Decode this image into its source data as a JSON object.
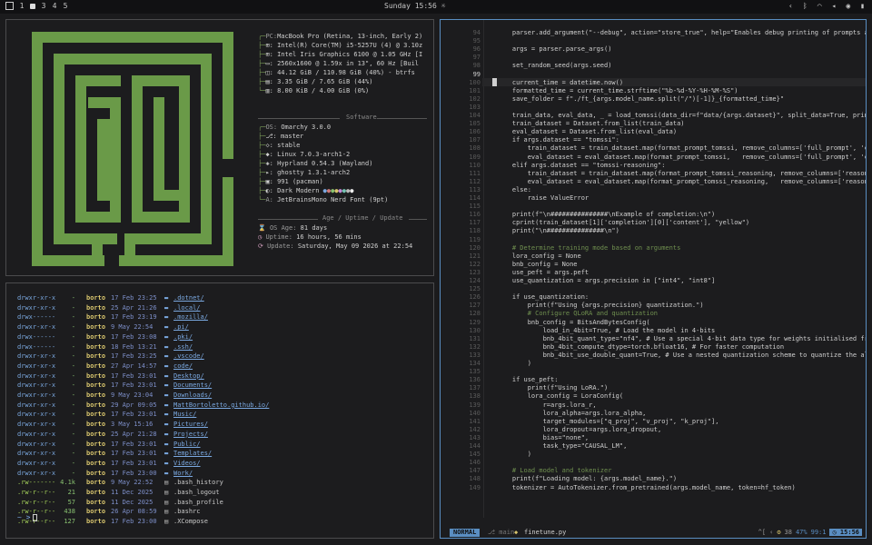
{
  "topbar": {
    "workspaces": [
      "1",
      "3",
      "4",
      "5"
    ],
    "clock": "Sunday 15:56",
    "tray_icons": [
      "chevron-left-icon",
      "bluetooth-icon",
      "wifi-icon",
      "volume-icon",
      "cpu-icon",
      "battery-icon"
    ]
  },
  "fetch": {
    "hw": [
      {
        "key": "PC:",
        "val": "MacBook Pro (Retina, 13-inch, Early 2)"
      },
      {
        "key": "",
        "val": "Intel(R) Core(TM) i5-5257U (4) @ 3.10z"
      },
      {
        "key": "",
        "val": "Intel Iris Graphics 6100 @ 1.05 GHz [I"
      },
      {
        "key": "",
        "val": "2560x1600 @ 1.59x in 13\", 60 Hz [Buil"
      },
      {
        "key": "",
        "val": "44.12 GiB / 110.98 GiB (40%) - btrfs"
      },
      {
        "key": "",
        "val": "3.35 GiB / 7.65 GiB (44%)"
      },
      {
        "key": "",
        "val": ": 8.00 KiB / 4.00 GiB (0%)"
      }
    ],
    "software_title": "Software",
    "sw": [
      {
        "key": "OS:",
        "val": "Omarchy 3.0.0"
      },
      {
        "key": "",
        "val": "master"
      },
      {
        "key": "",
        "val": "stable"
      },
      {
        "key": "",
        "val": "Linux 7.0.3-arch1-2"
      },
      {
        "key": "",
        "val": "Hyprland 0.54.3 (Wayland)"
      },
      {
        "key": "",
        "val": "ghostty 1.3.1-arch2"
      },
      {
        "key": "",
        "val": "991 (pacman)"
      },
      {
        "key": "",
        "val": "Dark Modern"
      },
      {
        "key": "A:",
        "val": "JetBrainsMono Nerd Font (9pt)"
      }
    ],
    "uptime_title": "Age / Uptime / Update",
    "age": {
      "key": "OS Age:",
      "val": "81 days"
    },
    "uptime": {
      "key": "Uptime:",
      "val": "16 hours, 56 mins"
    },
    "update": {
      "key": "Update:",
      "val": "Saturday, May 09 2026 at 22:54"
    }
  },
  "ls": {
    "rows": [
      {
        "perm": "drwxr-xr-x",
        "size": "-",
        "user": "borto",
        "date": "17 Feb 23:25",
        "name": ".dotnet/",
        "dir": true
      },
      {
        "perm": "drwxr-xr-x",
        "size": "-",
        "user": "borto",
        "date": "25 Apr 21:26",
        "name": ".local/",
        "dir": true
      },
      {
        "perm": "drwx------",
        "size": "-",
        "user": "borto",
        "date": "17 Feb 23:19",
        "name": ".mozilla/",
        "dir": true
      },
      {
        "perm": "drwxr-xr-x",
        "size": "-",
        "user": "borto",
        "date": "9 May 22:54",
        "name": ".pi/",
        "dir": true
      },
      {
        "perm": "drwx------",
        "size": "-",
        "user": "borto",
        "date": "17 Feb 23:08",
        "name": ".pki/",
        "dir": true
      },
      {
        "perm": "drwx------",
        "size": "-",
        "user": "borto",
        "date": "18 Feb 13:21",
        "name": ".ssh/",
        "dir": true
      },
      {
        "perm": "drwxr-xr-x",
        "size": "-",
        "user": "borto",
        "date": "17 Feb 23:25",
        "name": ".vscode/",
        "dir": true
      },
      {
        "perm": "drwxr-xr-x",
        "size": "-",
        "user": "borto",
        "date": "27 Apr 14:57",
        "name": "code/",
        "dir": true
      },
      {
        "perm": "drwxr-xr-x",
        "size": "-",
        "user": "borto",
        "date": "17 Feb 23:01",
        "name": "Desktop/",
        "dir": true
      },
      {
        "perm": "drwxr-xr-x",
        "size": "-",
        "user": "borto",
        "date": "17 Feb 23:01",
        "name": "Documents/",
        "dir": true
      },
      {
        "perm": "drwxr-xr-x",
        "size": "-",
        "user": "borto",
        "date": "9 May 23:04",
        "name": "Downloads/",
        "dir": true
      },
      {
        "perm": "drwxr-xr-x",
        "size": "-",
        "user": "borto",
        "date": "29 Apr 09:05",
        "name": "MattBortoletto.github.io/",
        "dir": true
      },
      {
        "perm": "drwxr-xr-x",
        "size": "-",
        "user": "borto",
        "date": "17 Feb 23:01",
        "name": "Music/",
        "dir": true
      },
      {
        "perm": "drwxr-xr-x",
        "size": "-",
        "user": "borto",
        "date": "3 May 15:16",
        "name": "Pictures/",
        "dir": true
      },
      {
        "perm": "drwxr-xr-x",
        "size": "-",
        "user": "borto",
        "date": "25 Apr 21:28",
        "name": "Projects/",
        "dir": true
      },
      {
        "perm": "drwxr-xr-x",
        "size": "-",
        "user": "borto",
        "date": "17 Feb 23:01",
        "name": "Public/",
        "dir": true
      },
      {
        "perm": "drwxr-xr-x",
        "size": "-",
        "user": "borto",
        "date": "17 Feb 23:01",
        "name": "Templates/",
        "dir": true
      },
      {
        "perm": "drwxr-xr-x",
        "size": "-",
        "user": "borto",
        "date": "17 Feb 23:01",
        "name": "Videos/",
        "dir": true
      },
      {
        "perm": "drwxr-xr-x",
        "size": "-",
        "user": "borto",
        "date": "17 Feb 23:00",
        "name": "Work/",
        "dir": true
      },
      {
        "perm": ".rw-------",
        "size": "4.1k",
        "user": "borto",
        "date": "9 May 22:52",
        "name": ".bash_history",
        "dir": false
      },
      {
        "perm": ".rw-r--r--",
        "size": "21",
        "user": "borto",
        "date": "11 Dec  2025",
        "name": ".bash_logout",
        "dir": false
      },
      {
        "perm": ".rw-r--r--",
        "size": "57",
        "user": "borto",
        "date": "11 Dec  2025",
        "name": ".bash_profile",
        "dir": false
      },
      {
        "perm": ".rw-r--r--",
        "size": "438",
        "user": "borto",
        "date": "26 Apr 08:59",
        "name": ".bashrc",
        "dir": false
      },
      {
        "perm": ".rw-r--r--",
        "size": "127",
        "user": "borto",
        "date": "17 Feb 23:00",
        "name": ".XCompose",
        "dir": false
      }
    ],
    "prompt": "~ >"
  },
  "editor": {
    "lines": [
      {
        "n": "94",
        "t": "    parser.add_argument(\"--debug\", action=\"store_true\", help=\"Enables debug printing of prompts an"
      },
      {
        "n": "95",
        "t": ""
      },
      {
        "n": "96",
        "t": "    args = parser.parse_args()"
      },
      {
        "n": "97",
        "t": ""
      },
      {
        "n": "98",
        "t": "    set_random_seed(args.seed)"
      },
      {
        "n": "99",
        "t": ""
      },
      {
        "n": "100",
        "t": "    current_time = datetime.now()"
      },
      {
        "n": "101",
        "t": "    formatted_time = current_time.strftime(\"%b-%d-%Y-%H-%M-%S\")"
      },
      {
        "n": "102",
        "t": "    save_folder = f\"./ft_{args.model_name.split(\"/\")[-1]}_{formatted_time}\""
      },
      {
        "n": "103",
        "t": ""
      },
      {
        "n": "104",
        "t": "    train_data, eval_data, _ = load_tomssi(data_dir=f\"data/{args.dataset}\", split_data=True, print"
      },
      {
        "n": "105",
        "t": "    train_dataset = Dataset.from_list(train_data)"
      },
      {
        "n": "106",
        "t": "    eval_dataset = Dataset.from_list(eval_data)"
      },
      {
        "n": "107",
        "t": "    if args.dataset == \"tomssi\":"
      },
      {
        "n": "108",
        "t": "        train_dataset = train_dataset.map(format_prompt_tomssi, remove_columns=['full_prompt', 'co"
      },
      {
        "n": "109",
        "t": "        eval_dataset = eval_dataset.map(format_prompt_tomssi,   remove_columns=['full_prompt', 'co"
      },
      {
        "n": "110",
        "t": "    elif args.dataset == \"tomssi-reasoning\":"
      },
      {
        "n": "111",
        "t": "        train_dataset = train_dataset.map(format_prompt_tomssi_reasoning, remove_columns=['reasoni"
      },
      {
        "n": "112",
        "t": "        eval_dataset = eval_dataset.map(format_prompt_tomssi_reasoning,   remove_columns=['reasoni"
      },
      {
        "n": "113",
        "t": "    else:"
      },
      {
        "n": "114",
        "t": "        raise ValueError"
      },
      {
        "n": "115",
        "t": ""
      },
      {
        "n": "116",
        "t": "    print(f\"\\n###############\\nExample of completion:\\n\")"
      },
      {
        "n": "117",
        "t": "    cprint(train_dataset[1]['completion'][0]['content'], \"yellow\")"
      },
      {
        "n": "118",
        "t": "    print(\"\\n###############\\n\")"
      },
      {
        "n": "119",
        "t": ""
      },
      {
        "n": "120",
        "t": "    # Determine training mode based on arguments"
      },
      {
        "n": "121",
        "t": "    lora_config = None"
      },
      {
        "n": "122",
        "t": "    bnb_config = None"
      },
      {
        "n": "123",
        "t": "    use_peft = args.peft"
      },
      {
        "n": "124",
        "t": "    use_quantization = args.precision in [\"int4\", \"int8\"]"
      },
      {
        "n": "125",
        "t": ""
      },
      {
        "n": "126",
        "t": "    if use_quantization:"
      },
      {
        "n": "127",
        "t": "        print(f\"Using {args.precision} quantization.\")"
      },
      {
        "n": "128",
        "t": "        # Configure QLoRA and quantization"
      },
      {
        "n": "129",
        "t": "        bnb_config = BitsAndBytesConfig("
      },
      {
        "n": "130",
        "t": "            load_in_4bit=True, # Load the model in 4-bits"
      },
      {
        "n": "131",
        "t": "            bnb_4bit_quant_type=\"nf4\", # Use a special 4-bit data type for weights initialised fro"
      },
      {
        "n": "132",
        "t": "            bnb_4bit_compute_dtype=torch.bfloat16, # For faster computation"
      },
      {
        "n": "133",
        "t": "            bnb_4bit_use_double_quant=True, # Use a nested quantization scheme to quantize the alr"
      },
      {
        "n": "134",
        "t": "        )"
      },
      {
        "n": "135",
        "t": ""
      },
      {
        "n": "136",
        "t": "    if use_peft:"
      },
      {
        "n": "137",
        "t": "        print(f\"Using LoRA.\")"
      },
      {
        "n": "138",
        "t": "        lora_config = LoraConfig("
      },
      {
        "n": "139",
        "t": "            r=args.lora_r,"
      },
      {
        "n": "140",
        "t": "            lora_alpha=args.lora_alpha,"
      },
      {
        "n": "141",
        "t": "            target_modules=[\"q_proj\", \"v_proj\", \"k_proj\"],"
      },
      {
        "n": "142",
        "t": "            lora_dropout=args.lora_dropout,"
      },
      {
        "n": "143",
        "t": "            bias=\"none\","
      },
      {
        "n": "144",
        "t": "            task_type=\"CAUSAL_LM\","
      },
      {
        "n": "145",
        "t": "        )"
      },
      {
        "n": "146",
        "t": ""
      },
      {
        "n": "147",
        "t": "    # Load model and tokenizer"
      },
      {
        "n": "148",
        "t": "    print(f\"Loading model: {args.model_name}.\")"
      },
      {
        "n": "149",
        "t": "    tokenizer = AutoTokenizer.from_pretrained(args.model_name, token=hf_token)"
      }
    ],
    "status": {
      "mode": "NORMAL",
      "branch": "main",
      "file": "finetune.py",
      "keys": "^[",
      "diag": "38",
      "percent": "47%",
      "position": "99:1",
      "time": "15:56"
    }
  },
  "colors": {
    "accent": "#5a8ec2",
    "logo_green": "#6a9a48",
    "dir_blue": "#7aa8e0"
  }
}
